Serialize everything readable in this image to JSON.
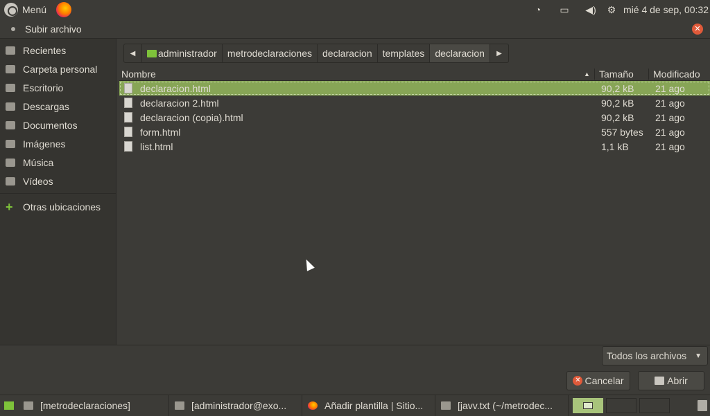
{
  "topbar": {
    "menu_label": "Menú",
    "clock": "mié  4 de sep, 00:32",
    "tray_icons": [
      "wifi-icon",
      "battery-icon",
      "volume-icon",
      "settings-icon"
    ]
  },
  "dialog": {
    "title": "Subir archivo",
    "close_icon": "close-icon"
  },
  "sidebar": {
    "items": [
      {
        "label": "Recientes",
        "icon": "recent-icon"
      },
      {
        "label": "Carpeta personal",
        "icon": "home-icon"
      },
      {
        "label": "Escritorio",
        "icon": "desktop-icon"
      },
      {
        "label": "Descargas",
        "icon": "downloads-icon"
      },
      {
        "label": "Documentos",
        "icon": "documents-icon"
      },
      {
        "label": "Imágenes",
        "icon": "pictures-icon"
      },
      {
        "label": "Música",
        "icon": "music-icon"
      },
      {
        "label": "Vídeos",
        "icon": "videos-icon"
      }
    ],
    "other": {
      "label": "Otras ubicaciones",
      "icon": "plus-icon"
    }
  },
  "pathbar": {
    "segments": [
      "administrador",
      "metrodeclaraciones",
      "declaracion",
      "templates",
      "declaracion"
    ]
  },
  "filelist": {
    "columns": {
      "name": "Nombre",
      "size": "Tamaño",
      "modified": "Modificado"
    },
    "rows": [
      {
        "name": "declaracion.html",
        "size": "90,2 kB",
        "modified": "21 ago"
      },
      {
        "name": "declaracion 2.html",
        "size": "90,2 kB",
        "modified": "21 ago"
      },
      {
        "name": "declaracion (copia).html",
        "size": "90,2 kB",
        "modified": "21 ago"
      },
      {
        "name": "form.html",
        "size": "557 bytes",
        "modified": "21 ago"
      },
      {
        "name": "list.html",
        "size": "1,1 kB",
        "modified": "21 ago"
      }
    ],
    "selected_index": 0
  },
  "footer": {
    "filter": "Todos los archivos",
    "cancel": "Cancelar",
    "open": "Abrir"
  },
  "taskbar": {
    "tasks": [
      "[metrodeclaraciones]",
      "[administrador@exo...",
      "Añadir plantilla | Sitio...",
      "[javv.txt (~/metrodec..."
    ]
  },
  "colors": {
    "accent": "#87a556",
    "background": "#3c3b37",
    "close": "#e05a3a"
  }
}
